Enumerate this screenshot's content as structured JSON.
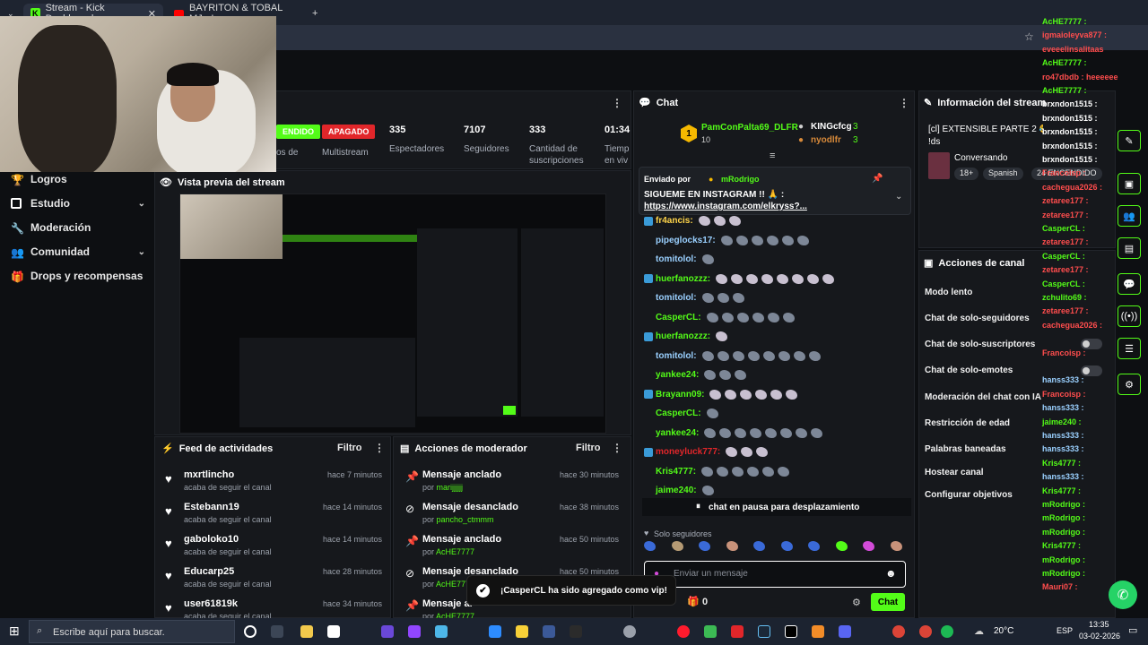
{
  "browser": {
    "tabs": [
      {
        "label": "Stream - Kick Dashboard"
      },
      {
        "label": "BAYRITON & TOBAL MJ - L"
      }
    ],
    "new_tab": "+"
  },
  "sidebar": {
    "items": [
      {
        "label": "Logros",
        "icon": "trophy-icon"
      },
      {
        "label": "Estudio",
        "icon": "studio-icon",
        "expandable": true
      },
      {
        "label": "Moderación",
        "icon": "wrench-icon"
      },
      {
        "label": "Comunidad",
        "icon": "community-icon",
        "expandable": true
      },
      {
        "label": "Drops y recompensas",
        "icon": "gift-icon"
      }
    ]
  },
  "stats": {
    "status_live": "ENDIDO",
    "status_off": "APAGADO",
    "live_label": "os de",
    "multistream_label": "Multistream",
    "viewers": "335",
    "viewers_label": "Espectadores",
    "followers": "7107",
    "followers_label": "Seguidores",
    "subs": "333",
    "subs_label_1": "Cantidad de",
    "subs_label_2": "suscripciones",
    "time": "01:34",
    "time_label_1": "Tiemp",
    "time_label_2": "en viv"
  },
  "preview": {
    "title": "Vista previa del stream"
  },
  "feed": {
    "title": "Feed de actividades",
    "filter_label": "Filtro",
    "items": [
      {
        "name": "mxrtlincho",
        "action": "acaba de seguir el canal",
        "time": "hace 7 minutos"
      },
      {
        "name": "Estebann19",
        "action": "acaba de seguir el canal",
        "time": "hace 14 minutos"
      },
      {
        "name": "gaboloko10",
        "action": "acaba de seguir el canal",
        "time": "hace 14 minutos"
      },
      {
        "name": "Educarp25",
        "action": "acaba de seguir el canal",
        "time": "hace 28 minutos"
      },
      {
        "name": "user61819k",
        "action": "acaba de seguir el canal",
        "time": "hace 34 minutos"
      }
    ]
  },
  "mod": {
    "title": "Acciones de moderador",
    "filter_label": "Filtro",
    "items": [
      {
        "action": "Mensaje anclado",
        "by_prefix": "por",
        "by": "marijjjjjj",
        "time": "hace 30 minutos"
      },
      {
        "action": "Mensaje desanclado",
        "by_prefix": "por",
        "by": "pancho_ctmmm",
        "time": "hace 38 minutos"
      },
      {
        "action": "Mensaje anclado",
        "by_prefix": "por",
        "by": "AcHE7777",
        "time": "hace 50 minutos"
      },
      {
        "action": "Mensaje desanclado",
        "by_prefix": "por",
        "by": "AcHE7777",
        "time": "hace 50 minutos"
      },
      {
        "action": "Mensaje ar",
        "by_prefix": "por",
        "by": "AcHE7777",
        "time": ""
      }
    ]
  },
  "chat": {
    "title": "Chat",
    "leaderboard": {
      "first_rank": "1",
      "first_name": "PamConPalta69_DLFR",
      "first_count": "10",
      "second_name": "KINGcfcg",
      "second_count": "3",
      "third_name": "nyodlfr",
      "third_count": "3"
    },
    "pinned": {
      "sent_by": "Enviado por",
      "sender": "mRodrigo",
      "message": "SIGUEME EN INSTAGRAM !! 🙏 :",
      "link": "https://www.instagram.com/elkryss?..."
    },
    "messages": [
      {
        "user": "fr4ancis:",
        "color": "#ffd54a"
      },
      {
        "user": "pipeglocks17:",
        "color": "#9ad0ff"
      },
      {
        "user": "tomitolol:",
        "color": "#9ad0ff"
      },
      {
        "user": "huerfanozzz:",
        "color": "#53fc18"
      },
      {
        "user": "tomitolol:",
        "color": "#9ad0ff"
      },
      {
        "user": "CasperCL:",
        "color": "#53fc18"
      },
      {
        "user": "huerfanozzz:",
        "color": "#53fc18"
      },
      {
        "user": "tomitolol:",
        "color": "#9ad0ff"
      },
      {
        "user": "yankee24:",
        "color": "#53fc18"
      },
      {
        "user": "Brayann09:",
        "color": "#53fc18"
      },
      {
        "user": "CasperCL:",
        "color": "#53fc18"
      },
      {
        "user": "yankee24:",
        "color": "#53fc18"
      },
      {
        "user": "moneyluck777:",
        "color": "#e1262a"
      },
      {
        "user": "Kris4777:",
        "color": "#53fc18"
      },
      {
        "user": "jaime240:",
        "color": "#53fc18"
      }
    ],
    "paused_label": "chat en pausa para desplazamiento",
    "followers_only": "Solo seguidores",
    "input_placeholder": "Enviar un mensaje",
    "points": "0",
    "send_label": "Chat"
  },
  "info": {
    "title": "Información del stream",
    "stream_title_1": "[cl] EXTENSIBLE PARTE 2 😂 | CasperCL",
    "stream_title_2": "!ds",
    "category": "Conversando",
    "tag_age": "18+",
    "tag_lang": "Spanish",
    "tag_extra": "24 ENCENDIDO"
  },
  "canal": {
    "title": "Acciones de canal",
    "items": [
      {
        "label": "Modo lento"
      },
      {
        "label": "Chat de solo-seguidores"
      },
      {
        "label": "Chat de solo-suscriptores"
      },
      {
        "label": "Chat de solo-emotes"
      },
      {
        "label": "Moderación del chat con IA"
      },
      {
        "label": "Restricción de edad"
      },
      {
        "label": "Palabras baneadas"
      },
      {
        "label": "Hostear canal"
      },
      {
        "label": "Configurar objetivos"
      }
    ]
  },
  "overlay": {
    "lines": [
      {
        "user": "AcHE7777 :",
        "color": "#53fc18"
      },
      {
        "user": "igmaioleyva877 :",
        "color": "#ff4d4d"
      },
      {
        "user": "eveeelinsalitaas",
        "color": "#ff4d4d"
      },
      {
        "user": "AcHE7777 :",
        "color": "#53fc18"
      },
      {
        "user": "ro47dbdb : heeeeee",
        "color": "#ff4d4d"
      },
      {
        "user": "AcHE7777 :",
        "color": "#53fc18"
      },
      {
        "user": "brxndon1515 :",
        "color": "#ffffff"
      },
      {
        "user": "brxndon1515 :",
        "color": "#ffffff"
      },
      {
        "user": "brxndon1515 :",
        "color": "#ffffff"
      },
      {
        "user": "brxndon1515 :",
        "color": "#ffffff"
      },
      {
        "user": "brxndon1515 :",
        "color": "#ffffff"
      },
      {
        "user": "Francoisp :",
        "color": "#ff4d4d"
      },
      {
        "user": "cachegua2026 :",
        "color": "#ff4d4d"
      },
      {
        "user": "zetaree177 :",
        "color": "#ff4d4d"
      },
      {
        "user": "zetaree177 :",
        "color": "#ff4d4d"
      },
      {
        "user": "CasperCL :",
        "color": "#53fc18"
      },
      {
        "user": "zetaree177 :",
        "color": "#ff4d4d"
      },
      {
        "user": "CasperCL :",
        "color": "#53fc18"
      },
      {
        "user": "zetaree177 :",
        "color": "#ff4d4d"
      },
      {
        "user": "CasperCL :",
        "color": "#53fc18"
      },
      {
        "user": "zchulito69 :",
        "color": "#53fc18"
      },
      {
        "user": "zetaree177 :",
        "color": "#ff4d4d"
      },
      {
        "user": "cachegua2026 :",
        "color": "#ff4d4d"
      },
      {
        "user": "",
        "color": "#ffffff"
      },
      {
        "user": "Francoisp :",
        "color": "#ff4d4d"
      },
      {
        "user": "",
        "color": "#ffffff"
      },
      {
        "user": "hanss333 :",
        "color": "#9ad0ff"
      },
      {
        "user": "Francoisp :",
        "color": "#ff4d4d"
      },
      {
        "user": "hanss333 :",
        "color": "#9ad0ff"
      },
      {
        "user": "jaime240 :",
        "color": "#53fc18"
      },
      {
        "user": "hanss333 :",
        "color": "#9ad0ff"
      },
      {
        "user": "hanss333 :",
        "color": "#9ad0ff"
      },
      {
        "user": "Kris4777 :",
        "color": "#53fc18"
      },
      {
        "user": "hanss333 :",
        "color": "#9ad0ff"
      },
      {
        "user": "Kris4777 :",
        "color": "#53fc18"
      },
      {
        "user": "mRodrigo :",
        "color": "#53fc18"
      },
      {
        "user": "mRodrigo :",
        "color": "#53fc18"
      },
      {
        "user": "mRodrigo :",
        "color": "#53fc18"
      },
      {
        "user": "Kris4777 :",
        "color": "#53fc18"
      },
      {
        "user": "mRodrigo :",
        "color": "#53fc18"
      },
      {
        "user": "mRodrigo :",
        "color": "#53fc18"
      },
      {
        "user": "Mauri07 :",
        "color": "#ff4d4d"
      }
    ]
  },
  "toast": {
    "message": "¡CasperCL ha sido agregado como vip!"
  },
  "taskbar": {
    "search_placeholder": "Escribe aquí para buscar.",
    "weather": "20°C",
    "lang": "ESP",
    "time": "13:35",
    "date": "03-02-2026"
  }
}
